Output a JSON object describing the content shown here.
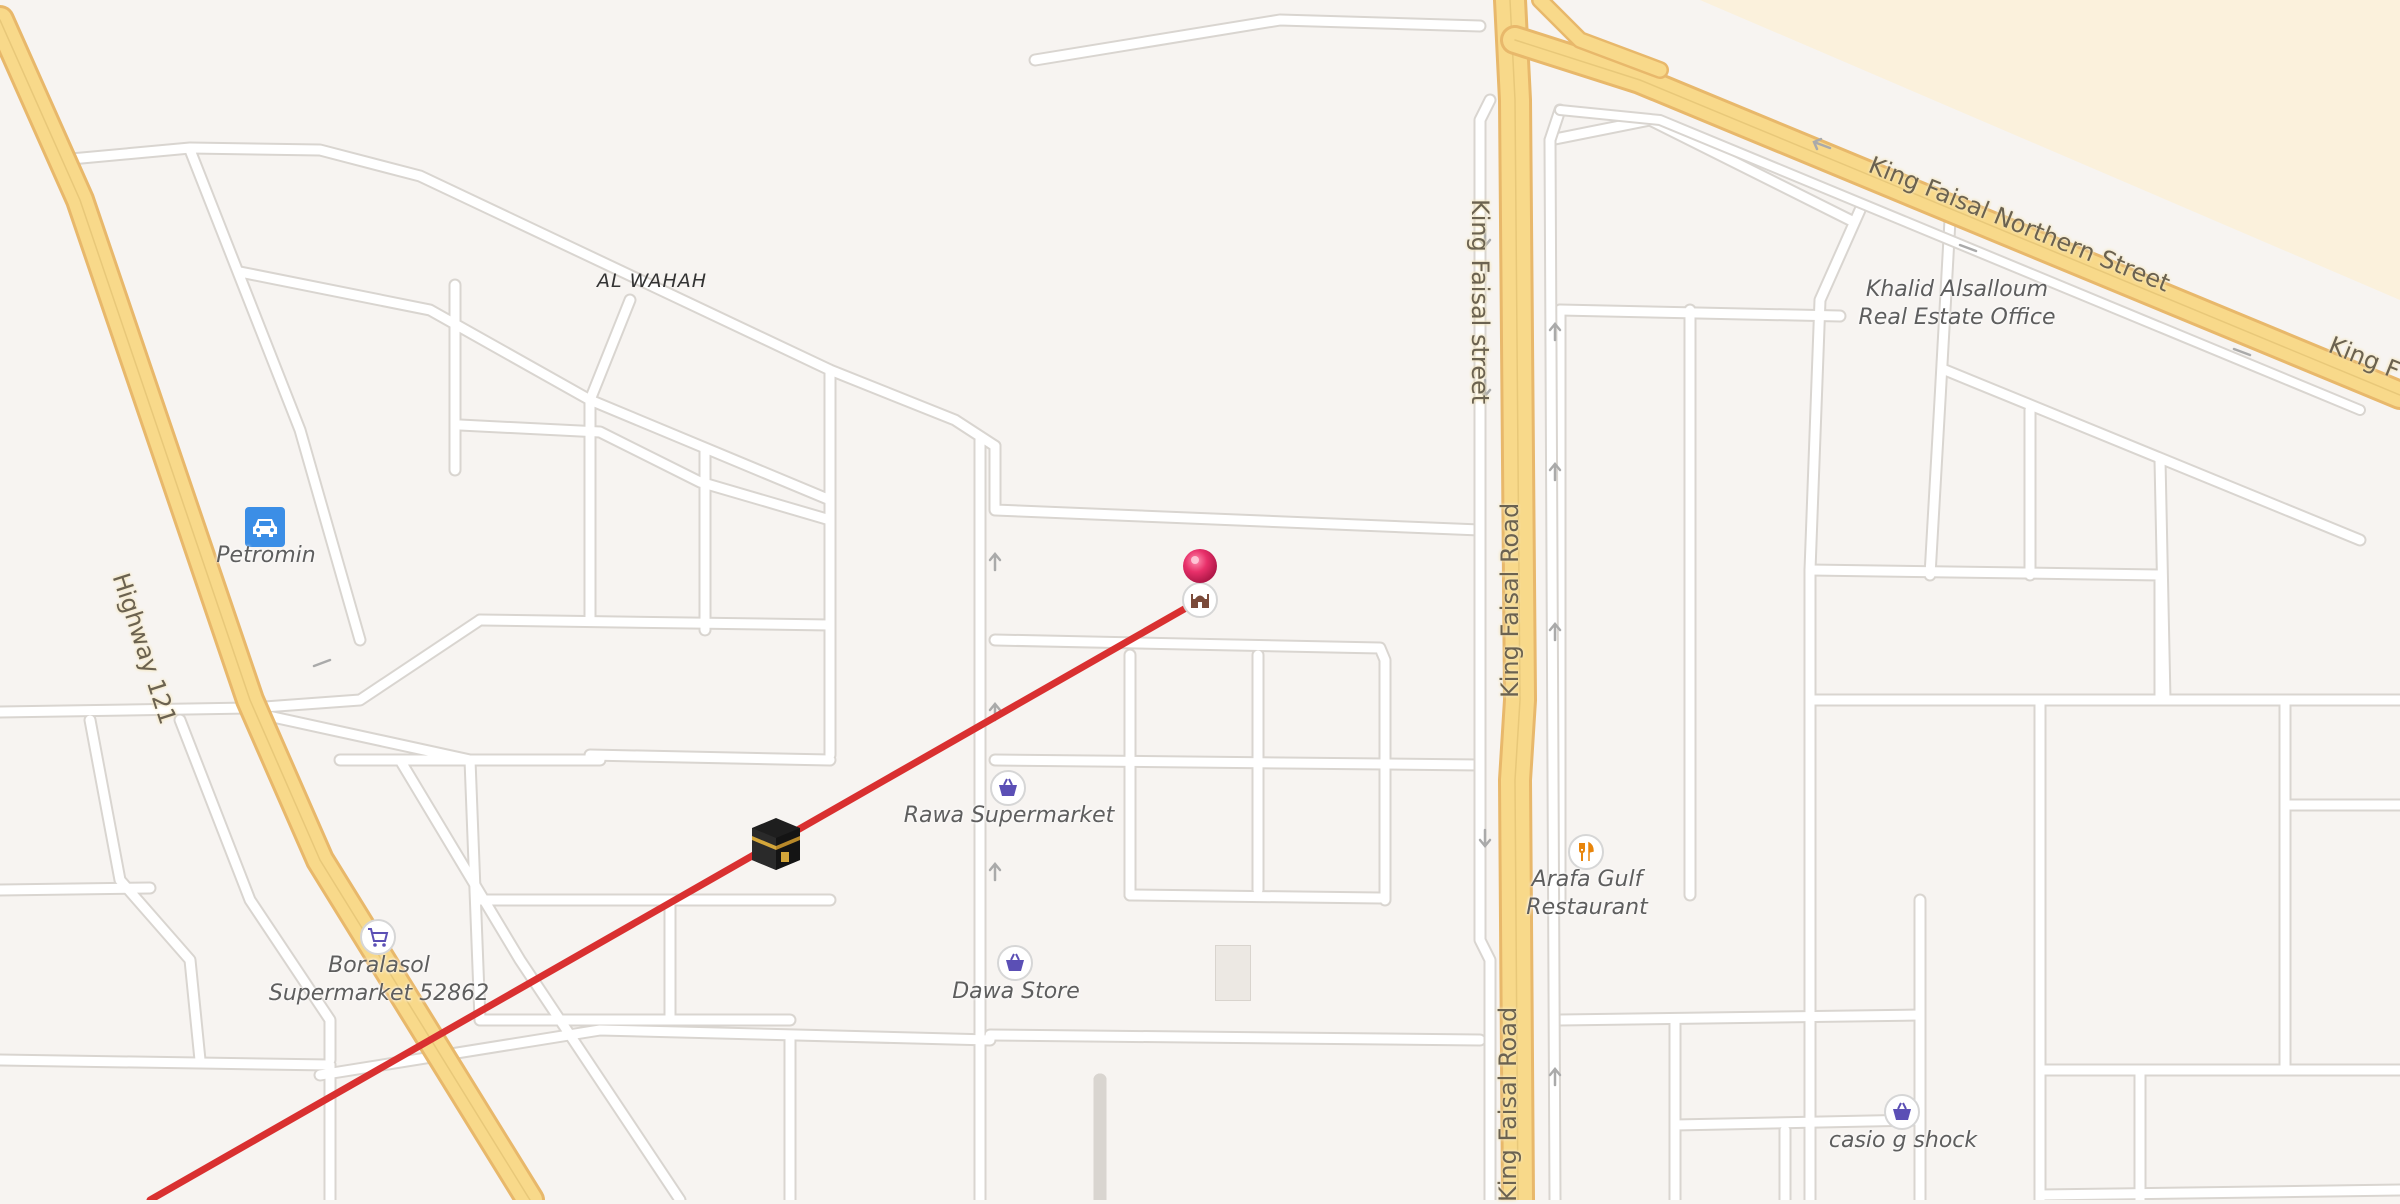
{
  "map": {
    "colors": {
      "background": "#f7f4f1",
      "street": "#ffffff",
      "street_casing": "#d9d5d0",
      "highway": "#f8d98a",
      "highway_casing": "#e8b86b",
      "direction_line": "#d93030",
      "pin": "#e8306a",
      "poi_icon": "#5b4fb5",
      "restaurant_icon": "#e8850b"
    },
    "roads": {
      "highway_121": "Highway 121",
      "king_faisal_street": "King Faisal street",
      "king_faisal_road_upper": "King Faisal Road",
      "king_faisal_road_lower": "King Faisal Road",
      "king_faisal_northern": "King Faisal Northern Street",
      "king_f_partial": "King F"
    },
    "district": "AL WAHAH",
    "places": {
      "petromin": "Petromin",
      "khalid_line1": "Khalid Alsalloum",
      "khalid_line2": "Real Estate Office",
      "rawa": "Rawa Supermarket",
      "arafa_line1": "Arafa Gulf",
      "arafa_line2": "Restaurant",
      "boralasol_line1": "Boralasol",
      "boralasol_line2": "Supermarket 52862",
      "dawa": "Dawa Store",
      "casio": "casio g shock"
    },
    "icons": {
      "petromin": "car-icon",
      "rawa": "shopping-basket-icon",
      "dawa": "shopping-basket-icon",
      "casio": "shopping-basket-icon",
      "boralasol": "shopping-cart-icon",
      "arafa": "restaurant-icon",
      "pin_poi": "mosque-icon",
      "destination": "pin-icon",
      "kaaba": "kaaba-icon"
    }
  }
}
